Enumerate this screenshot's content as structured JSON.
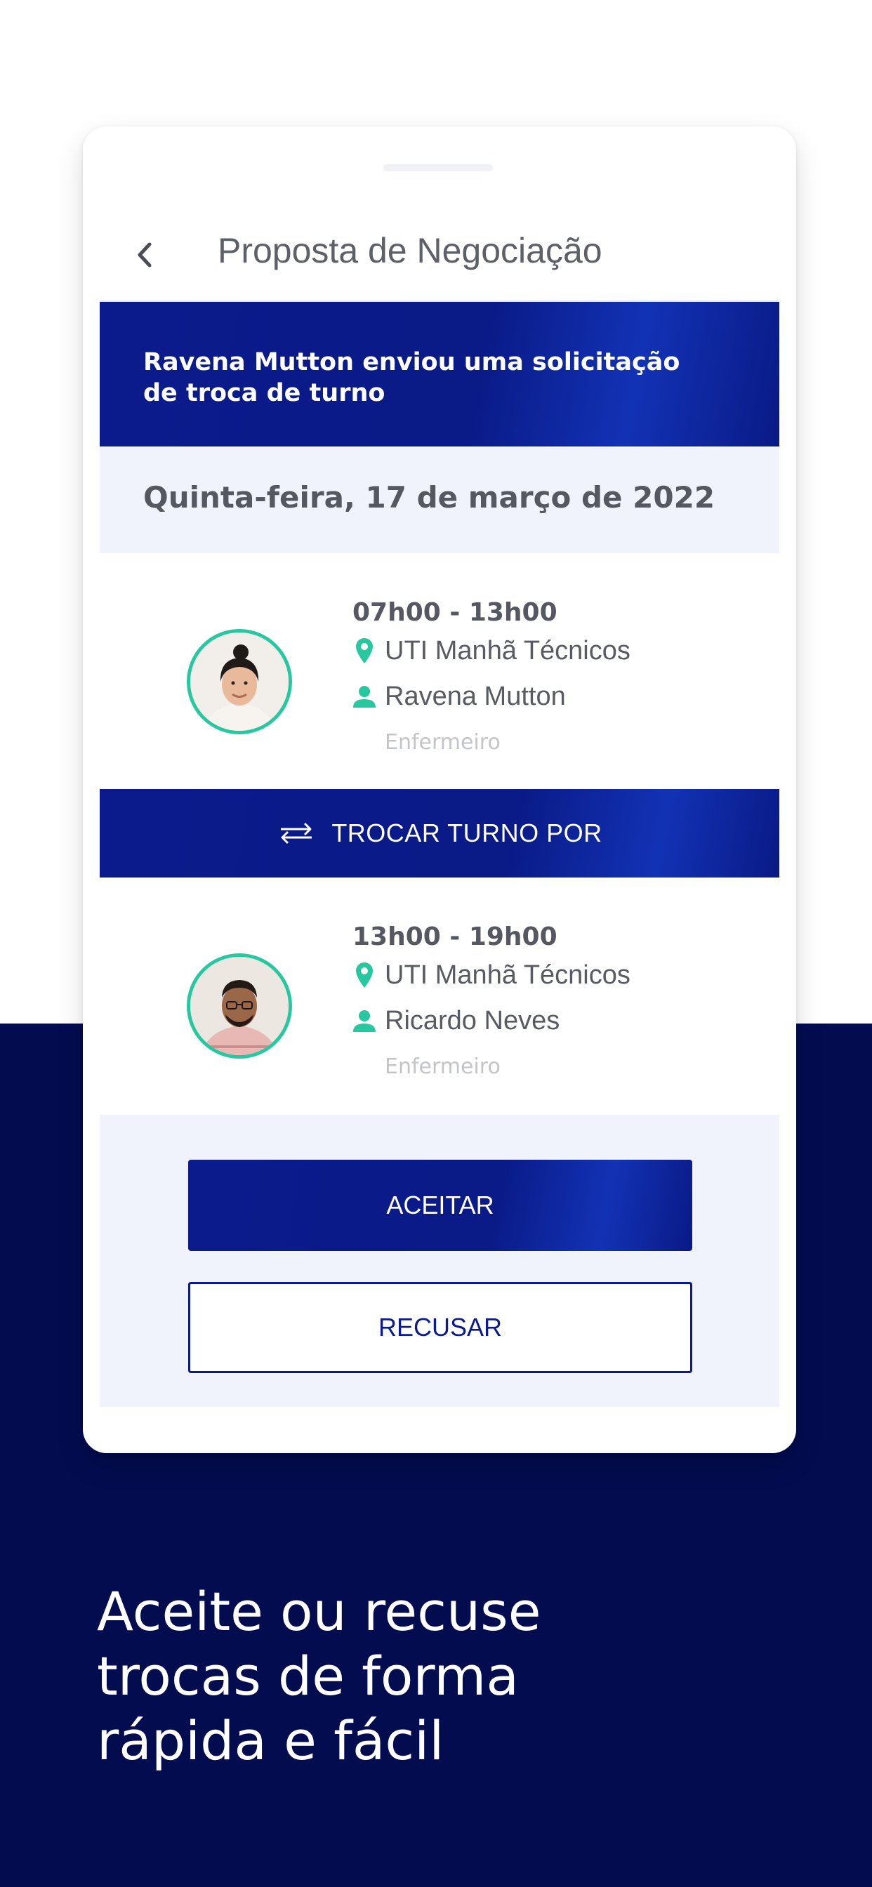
{
  "colors": {
    "navy_background": "#030c4f",
    "primary_blue": "#0b1b8c",
    "accent_green": "#27c7a0",
    "light_panel": "#f1f3fc"
  },
  "header": {
    "back_icon": "chevron-left-icon",
    "title": "Proposta de Negociação"
  },
  "banner": {
    "message": "Ravena Mutton enviou uma solicitação de troca de turno"
  },
  "date": "Quinta-feira, 17 de março de 2022",
  "shifts": [
    {
      "time": "07h00 - 13h00",
      "location_icon": "map-pin-icon",
      "location": "UTI Manhã Técnicos",
      "person_icon": "person-icon",
      "person": "Ravena Mutton",
      "role": "Enfermeiro"
    },
    {
      "time": "13h00 - 19h00",
      "location_icon": "map-pin-icon",
      "location": "UTI Manhã Técnicos",
      "person_icon": "person-icon",
      "person": "Ricardo Neves",
      "role": "Enfermeiro"
    }
  ],
  "swap": {
    "icon": "swap-arrows-icon",
    "label": "TROCAR TURNO POR"
  },
  "actions": {
    "accept_label": "ACEITAR",
    "refuse_label": "RECUSAR"
  },
  "tagline": [
    "Aceite ou recuse",
    "trocas de forma",
    "rápida e fácil"
  ]
}
